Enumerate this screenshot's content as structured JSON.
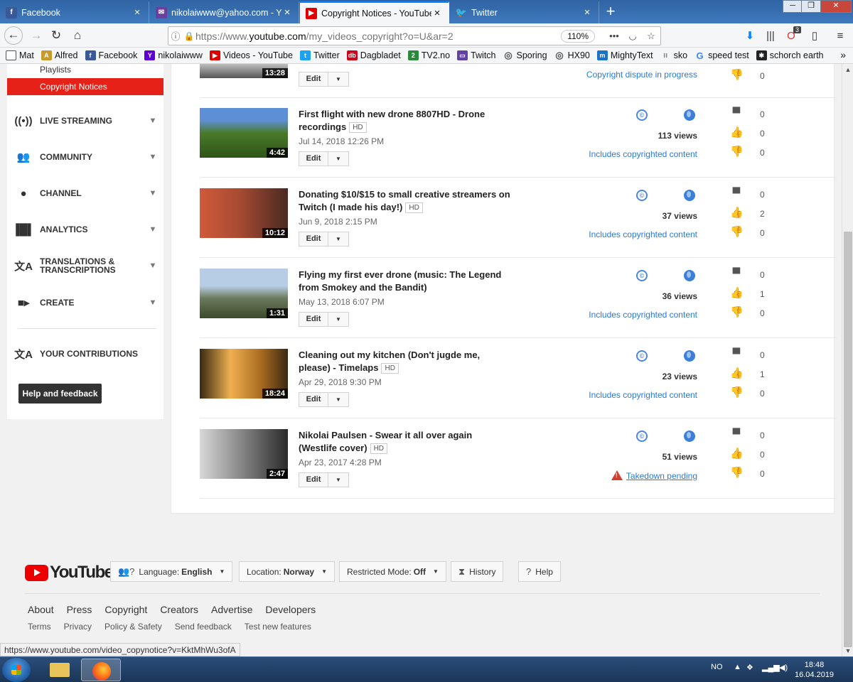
{
  "browser": {
    "tabs": [
      {
        "label": "Facebook",
        "icon": "facebook-icon",
        "color": "#3b5998"
      },
      {
        "label": "nikolaiwww@yahoo.com - Yah",
        "icon": "mail-icon",
        "color": "#6b3fa0"
      },
      {
        "label": "Copyright Notices - YouTube",
        "icon": "youtube-icon",
        "color": "#e00000"
      },
      {
        "label": "Twitter",
        "icon": "twitter-icon",
        "color": "#1da1f2"
      }
    ],
    "url_prefix": "https://www.",
    "url_domain": "youtube.com",
    "url_path": "/my_videos_copyright?o=U&ar=2",
    "zoom": "110%",
    "notification_count": "3",
    "bookmarks": [
      {
        "label": "Mat",
        "icon": "folder-icon",
        "color": "#555"
      },
      {
        "label": "Alfred",
        "icon": "alfred-icon",
        "color": "#c79a2b"
      },
      {
        "label": "Facebook",
        "icon": "facebook-icon",
        "color": "#3b5998"
      },
      {
        "label": "nikolaiwww",
        "icon": "yahoo-icon",
        "color": "#5f01d1"
      },
      {
        "label": "Videos - YouTube",
        "icon": "youtube-icon",
        "color": "#e00000"
      },
      {
        "label": "Twitter",
        "icon": "twitter-icon",
        "color": "#1da1f2"
      },
      {
        "label": "Dagbladet",
        "icon": "dagbladet-icon",
        "color": "#d0021b"
      },
      {
        "label": "TV2.no",
        "icon": "tv2-icon",
        "color": "#2a8a3a"
      },
      {
        "label": "Twitch",
        "icon": "twitch-icon",
        "color": "#6441a5"
      },
      {
        "label": "Sporing",
        "icon": "globe-icon",
        "color": "#555"
      },
      {
        "label": "HX90",
        "icon": "globe-icon",
        "color": "#555"
      },
      {
        "label": "MightyText",
        "icon": "mightytext-icon",
        "color": "#1a73c9"
      },
      {
        "label": "sko",
        "icon": "sko-icon",
        "color": "#888"
      },
      {
        "label": "speed test",
        "icon": "google-icon",
        "color": "#4285f4"
      },
      {
        "label": "schorch earth",
        "icon": "schorch-icon",
        "color": "#222"
      }
    ],
    "status_url": "https://www.youtube.com/video_copynotice?v=KktMhWu3ofA"
  },
  "sidebar": {
    "playlists": "Playlists",
    "active": "Copyright Notices",
    "items": [
      {
        "label": "LIVE STREAMING",
        "icon": "live-streaming-icon"
      },
      {
        "label": "COMMUNITY",
        "icon": "community-icon"
      },
      {
        "label": "CHANNEL",
        "icon": "channel-icon"
      },
      {
        "label": "ANALYTICS",
        "icon": "analytics-icon"
      },
      {
        "label": "TRANSLATIONS & TRANSCRIPTIONS",
        "icon": "translate-icon"
      },
      {
        "label": "CREATE",
        "icon": "create-icon"
      }
    ],
    "contributions": "YOUR CONTRIBUTIONS",
    "help": "Help and feedback"
  },
  "videos": [
    {
      "title": "",
      "hd": "",
      "date": "",
      "duration": "13:28",
      "views": "",
      "status": "Copyright dispute in progress",
      "comments": "",
      "likes": "",
      "dislikes": "0",
      "thumb": [
        "#1a1a1a",
        "#e8e8e8",
        "#555555"
      ]
    },
    {
      "title": "First flight with new drone 8807HD - Drone recordings",
      "hd": "HD",
      "date": "Jul 14, 2018 12:26 PM",
      "duration": "4:42",
      "views": "113 views",
      "status": "Includes copyrighted content",
      "comments": "0",
      "likes": "0",
      "dislikes": "0",
      "thumb": [
        "#5d8fd6",
        "#4a7a2a",
        "#2e5518"
      ]
    },
    {
      "title": "Donating $10/$15 to small creative streamers on Twitch (I made his day!)",
      "hd": "HD",
      "date": "Jun 9, 2018 2:15 PM",
      "duration": "10:12",
      "views": "37 views",
      "status": "Includes copyrighted content",
      "comments": "0",
      "likes": "2",
      "dislikes": "0",
      "thumb": [
        "#d05a3a",
        "#a74a32",
        "#4a2a22"
      ]
    },
    {
      "title": "Flying my first ever drone (music: The Legend from Smokey and the Bandit)",
      "hd": "",
      "date": "May 13, 2018 6:07 PM",
      "duration": "1:31",
      "views": "36 views",
      "status": "Includes copyrighted content",
      "comments": "0",
      "likes": "1",
      "dislikes": "0",
      "thumb": [
        "#b7cde6",
        "#6a7a5a",
        "#3a4a2a"
      ]
    },
    {
      "title": "Cleaning out my kitchen (Don't jugde me, please) - Timelaps",
      "hd": "HD",
      "date": "Apr 29, 2018 9:30 PM",
      "duration": "18:24",
      "views": "23 views",
      "status": "Includes copyrighted content",
      "comments": "0",
      "likes": "1",
      "dislikes": "0",
      "thumb": [
        "#f0b050",
        "#a86a20",
        "#3a2a12"
      ]
    },
    {
      "title": "Nikolai Paulsen - Swear it all over again (Westlife cover)",
      "hd": "HD",
      "date": "Apr 23, 2017 4:28 PM",
      "duration": "2:47",
      "views": "51 views",
      "status": "Takedown pending",
      "comments": "0",
      "likes": "0",
      "dislikes": "0",
      "thumb": [
        "#d8d8d8",
        "#8a8a8a",
        "#2a2a2a"
      ]
    }
  ],
  "edit_label": "Edit",
  "copyright_glyph": "©",
  "footer": {
    "logo": "YouTube",
    "language_label": "Language:",
    "language_value": "English",
    "location_label": "Location:",
    "location_value": "Norway",
    "restricted_label": "Restricted Mode:",
    "restricted_value": "Off",
    "history": "History",
    "help": "Help",
    "links1": [
      "About",
      "Press",
      "Copyright",
      "Creators",
      "Advertise",
      "Developers"
    ],
    "links2": [
      "Terms",
      "Privacy",
      "Policy & Safety",
      "Send feedback",
      "Test new features"
    ]
  },
  "taskbar": {
    "lang": "NO",
    "time": "18:48",
    "date": "16.04.2019"
  },
  "colors": {
    "youtube_red": "#e62117",
    "link_blue": "#2a7ad3",
    "icon_blue": "#4a86e8"
  }
}
